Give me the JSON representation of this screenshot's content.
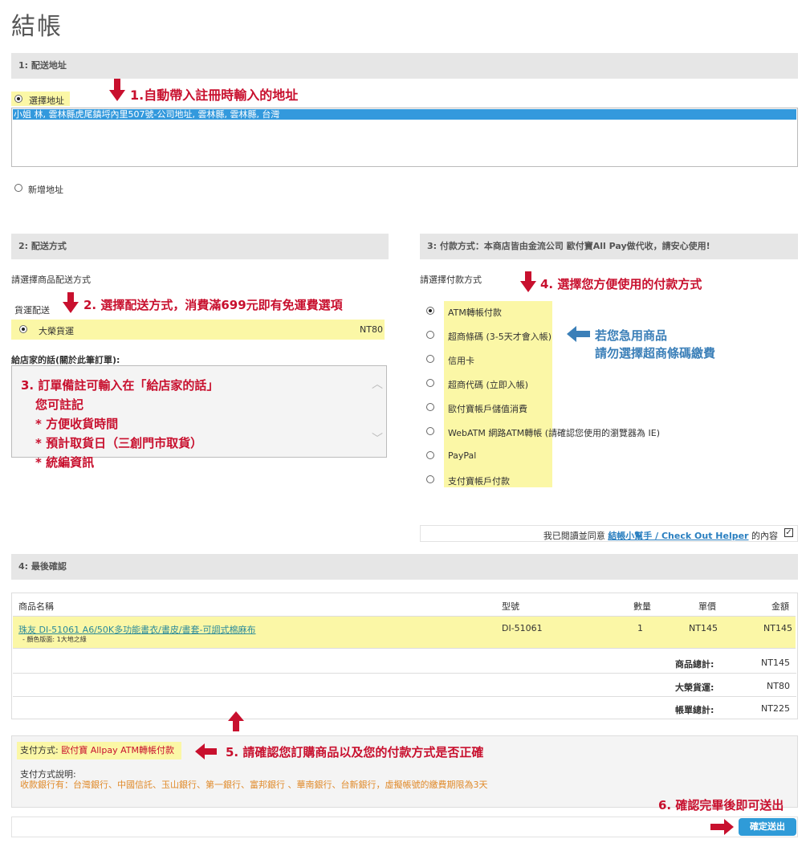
{
  "page_title": "結帳",
  "section1": {
    "header": "1: 配送地址",
    "select_address_label": "選擇地址",
    "selected_address": "小姐 林, 雲林縣虎尾鎮埒內里507號-公司地址, 雲林縣, 雲林縣, 台灣",
    "new_address_label": "新增地址"
  },
  "section2": {
    "header": "2: 配送方式",
    "prompt": "請選擇商品配送方式",
    "group_label": "貨運配送",
    "option_label": "大榮貨運",
    "option_price": "NT80",
    "message_label": "給店家的話(關於此筆訂單):"
  },
  "section3": {
    "header": "3: 付款方式：本商店皆由金流公司 歐付寶All Pay做代收，請安心使用!",
    "prompt": "請選擇付款方式",
    "options": [
      "ATM轉帳付款",
      "超商條碼 (3-5天才會入帳)",
      "信用卡",
      "超商代碼 (立即入帳)",
      "歐付寶帳戶儲值消費",
      "WebATM 網路ATM轉帳 (請確認您使用的瀏覽器為 IE)",
      "PayPal",
      "支付寶帳戶付款"
    ],
    "agree_prefix": "我已閱讀並同意",
    "agree_link": "結帳小幫手 / Check Out Helper",
    "agree_suffix": "的內容"
  },
  "section4": {
    "header": "4: 最後確認",
    "columns": {
      "name": "商品名稱",
      "model": "型號",
      "qty": "數量",
      "unit": "單價",
      "total": "金額"
    },
    "item": {
      "name": "珠友 DI-51061 A6/50K多功能書衣/書皮/書套-可調式棉麻布",
      "option": "- 顏色版面: 1大地之綠",
      "model": "DI-51061",
      "qty": "1",
      "unit_price": "NT145",
      "amount": "NT145"
    },
    "subtotal_label": "商品總計:",
    "subtotal_value": "NT145",
    "shipping_label": "大榮貨運:",
    "shipping_value": "NT80",
    "grand_label": "帳單總計:",
    "grand_value": "NT225",
    "payment_method_label": "支付方式:",
    "payment_method_value": "歐付寶 Allpay ATM轉帳付款",
    "payment_desc_label": "支付方式說明:",
    "payment_desc_value": "收款銀行有：台灣銀行、中國信託、玉山銀行、第一銀行、富邦銀行 、華南銀行、台新銀行，虛擬帳號的繳費期限為3天",
    "confirm_button": "確定送出"
  },
  "annotations": {
    "a1": "1.自動帶入註冊時輸入的地址",
    "a2": "2. 選擇配送方式，消費滿699元即有免運費選項",
    "a3_lines": [
      "3. 訂單備註可輸入在「給店家的話」",
      "您可註記",
      "* 方便收貨時間",
      "* 預計取貨日（三創門市取貨）",
      "* 統編資訊"
    ],
    "a4": "4. 選擇您方便使用的付款方式",
    "blue_lines": [
      "若您急用商品",
      "請勿選擇超商條碼繳費"
    ],
    "a5": "5. 請確認您訂購商品以及您的付款方式是否正確",
    "a6": "6. 確認完畢後即可送出"
  },
  "colors": {
    "annotation_red": "#c8102e",
    "annotation_blue": "#3b7fb8",
    "highlight": "#fbf7a6",
    "selected_row": "#3399dd",
    "button": "#2f9bd8"
  }
}
